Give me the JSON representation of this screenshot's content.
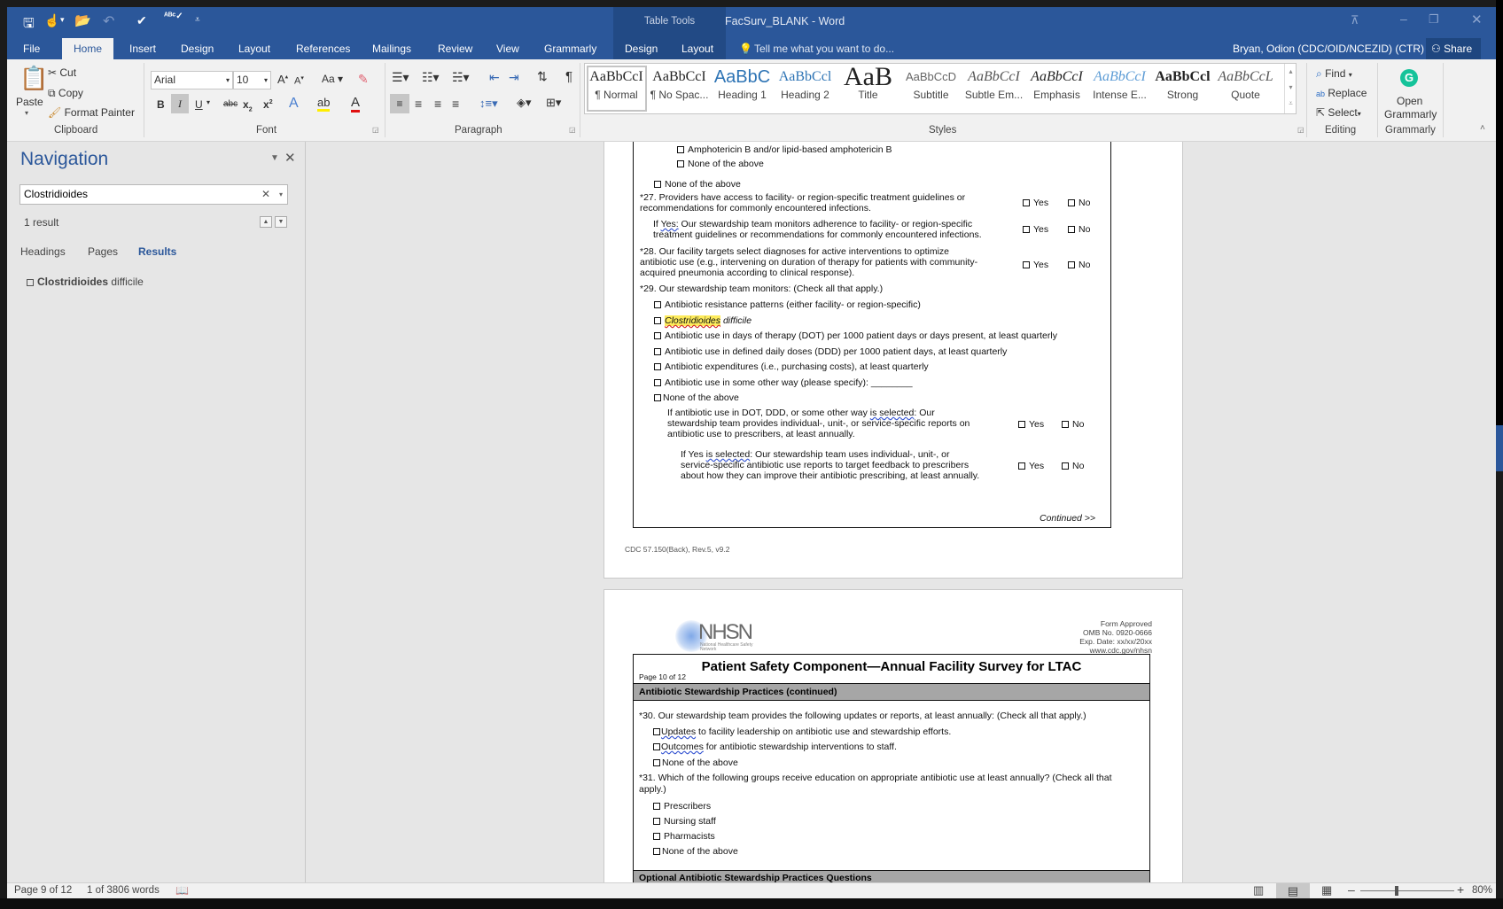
{
  "titlebar": {
    "title": "57.150_LTACFacSurv_BLANK - Word",
    "table_tools": "Table Tools"
  },
  "tabs": {
    "file": "File",
    "home": "Home",
    "insert": "Insert",
    "design": "Design",
    "layout": "Layout",
    "references": "References",
    "mailings": "Mailings",
    "review": "Review",
    "view": "View",
    "grammarly": "Grammarly",
    "tt_design": "Design",
    "tt_layout": "Layout",
    "tell_me": "Tell me what you want to do...",
    "user": "Bryan, Odion (CDC/OID/NCEZID) (CTR)",
    "share": "Share"
  },
  "ribbon": {
    "clipboard": {
      "paste": "Paste",
      "cut": "Cut",
      "copy": "Copy",
      "format_painter": "Format Painter",
      "label": "Clipboard"
    },
    "font": {
      "name": "Arial",
      "size": "10",
      "label": "Font",
      "change_case": "Aa"
    },
    "paragraph": {
      "label": "Paragraph"
    },
    "styles": {
      "label": "Styles",
      "items": [
        {
          "preview": "AaBbCcI",
          "name": "¶ Normal"
        },
        {
          "preview": "AaBbCcI",
          "name": "¶ No Spac..."
        },
        {
          "preview": "AaBbC",
          "name": "Heading 1"
        },
        {
          "preview": "AaBbCcl",
          "name": "Heading 2"
        },
        {
          "preview": "AaB",
          "name": "Title"
        },
        {
          "preview": "AaBbCcD",
          "name": "Subtitle"
        },
        {
          "preview": "AaBbCcI",
          "name": "Subtle Em..."
        },
        {
          "preview": "AaBbCcI",
          "name": "Emphasis"
        },
        {
          "preview": "AaBbCcI",
          "name": "Intense E..."
        },
        {
          "preview": "AaBbCcl",
          "name": "Strong"
        },
        {
          "preview": "AaBbCcL",
          "name": "Quote"
        }
      ]
    },
    "editing": {
      "find": "Find",
      "replace": "Replace",
      "select": "Select",
      "label": "Editing"
    },
    "grammarly": {
      "open1": "Open",
      "open2": "Grammarly",
      "label": "Grammarly"
    }
  },
  "nav": {
    "title": "Navigation",
    "search_value": "Clostridioides",
    "result_count": "1 result",
    "tabs": [
      "Headings",
      "Pages",
      "Results"
    ],
    "result": {
      "bold": "Clostridioides",
      "rest": " difficile"
    }
  },
  "page1": {
    "l1": "Amphotericin B and/or lipid-based amphotericin B",
    "l2": "None of the above",
    "l3": "None of the above",
    "q27a": "*27. Providers have access to facility- or region-specific treatment guidelines or",
    "q27b": "recommendations for commonly encountered infections.",
    "ify1a": "If ",
    "ify1b": "Yes:",
    "ify1c": " Our stewardship team monitors adherence to facility- or region-specific",
    "ify2": "treatment guidelines or recommendations for commonly encountered infections.",
    "q28a": "*28. Our facility targets select diagnoses for active interventions to optimize",
    "q28b": "antibiotic use (e.g., intervening on duration of therapy for patients with community-",
    "q28c": "acquired pneumonia according to clinical response).",
    "q29": "*29. Our stewardship team monitors: (Check all that apply.)",
    "i1": "Antibiotic resistance patterns (either facility- or region-specific)",
    "i2a": "Clostridioides",
    "i2b": " difficile",
    "i3": "Antibiotic use in days of therapy (DOT) per 1000 patient days or days present, at least quarterly",
    "i4": "Antibiotic use in defined daily doses (DDD) per 1000 patient days, at least quarterly",
    "i5": "Antibiotic expenditures (i.e., purchasing costs), at least quarterly",
    "i6": "Antibiotic use in some other way (please specify): ________",
    "i7": "None of the above",
    "ifa1a": "If antibiotic use in DOT, DDD, or some other way ",
    "ifa1b": "is selected",
    ": Our": "",
    "ifa1c": ": Our",
    "ifa2": "stewardship team provides individual-, unit-, or service-specific reports on",
    "ifa3": "antibiotic use to prescribers, at least annually.",
    "ifb1a": "If Yes ",
    "ifb1b": "is selected",
    "ifb1c": ": Our stewardship team uses individual-, unit-, or",
    "ifb2": "service-specific antibiotic use reports to target feedback to prescribers",
    "ifb3": "about how they can improve their antibiotic prescribing, at least annually.",
    "yes": "Yes",
    "no": "No",
    "continued": "Continued >>",
    "footer": "CDC 57.150(Back), Rev.5, v9.2"
  },
  "page2": {
    "logo_text": "NHSN",
    "logo_sub": "National Healthcare Safety Network",
    "form1": "Form Approved",
    "form2": "OMB No. 0920-0666",
    "form3": "Exp. Date: xx/xx/20xx",
    "form4": "www.cdc.gov/nhsn",
    "title": "Patient Safety Component—Annual Facility Survey for LTAC",
    "page": "Page 10 of 12",
    "section": "Antibiotic Stewardship Practices (continued)",
    "q30": "*30. Our stewardship team provides the following updates or reports, at least annually: (Check all that apply.)",
    "u1a": "Updates",
    "u1b": " to facility leadership on antibiotic use and stewardship efforts.",
    "u2a": "Outcomes",
    "u2b": " for antibiotic stewardship interventions to staff.",
    "u3": "None of the above",
    "q31a": "*31. Which of the following groups receive education on appropriate antibiotic use at least annually? (Check all that",
    "q31b": "apply.)",
    "g1": "Prescribers",
    "g2": "Nursing staff",
    "g3": "Pharmacists",
    "g4": "None of the above",
    "next_section": "Optional Antibiotic Stewardship Practices Questions"
  },
  "status": {
    "page": "Page 9 of 12",
    "words": "1 of 3806 words",
    "zoom": "80%",
    "zoom_level_percent": 80
  }
}
